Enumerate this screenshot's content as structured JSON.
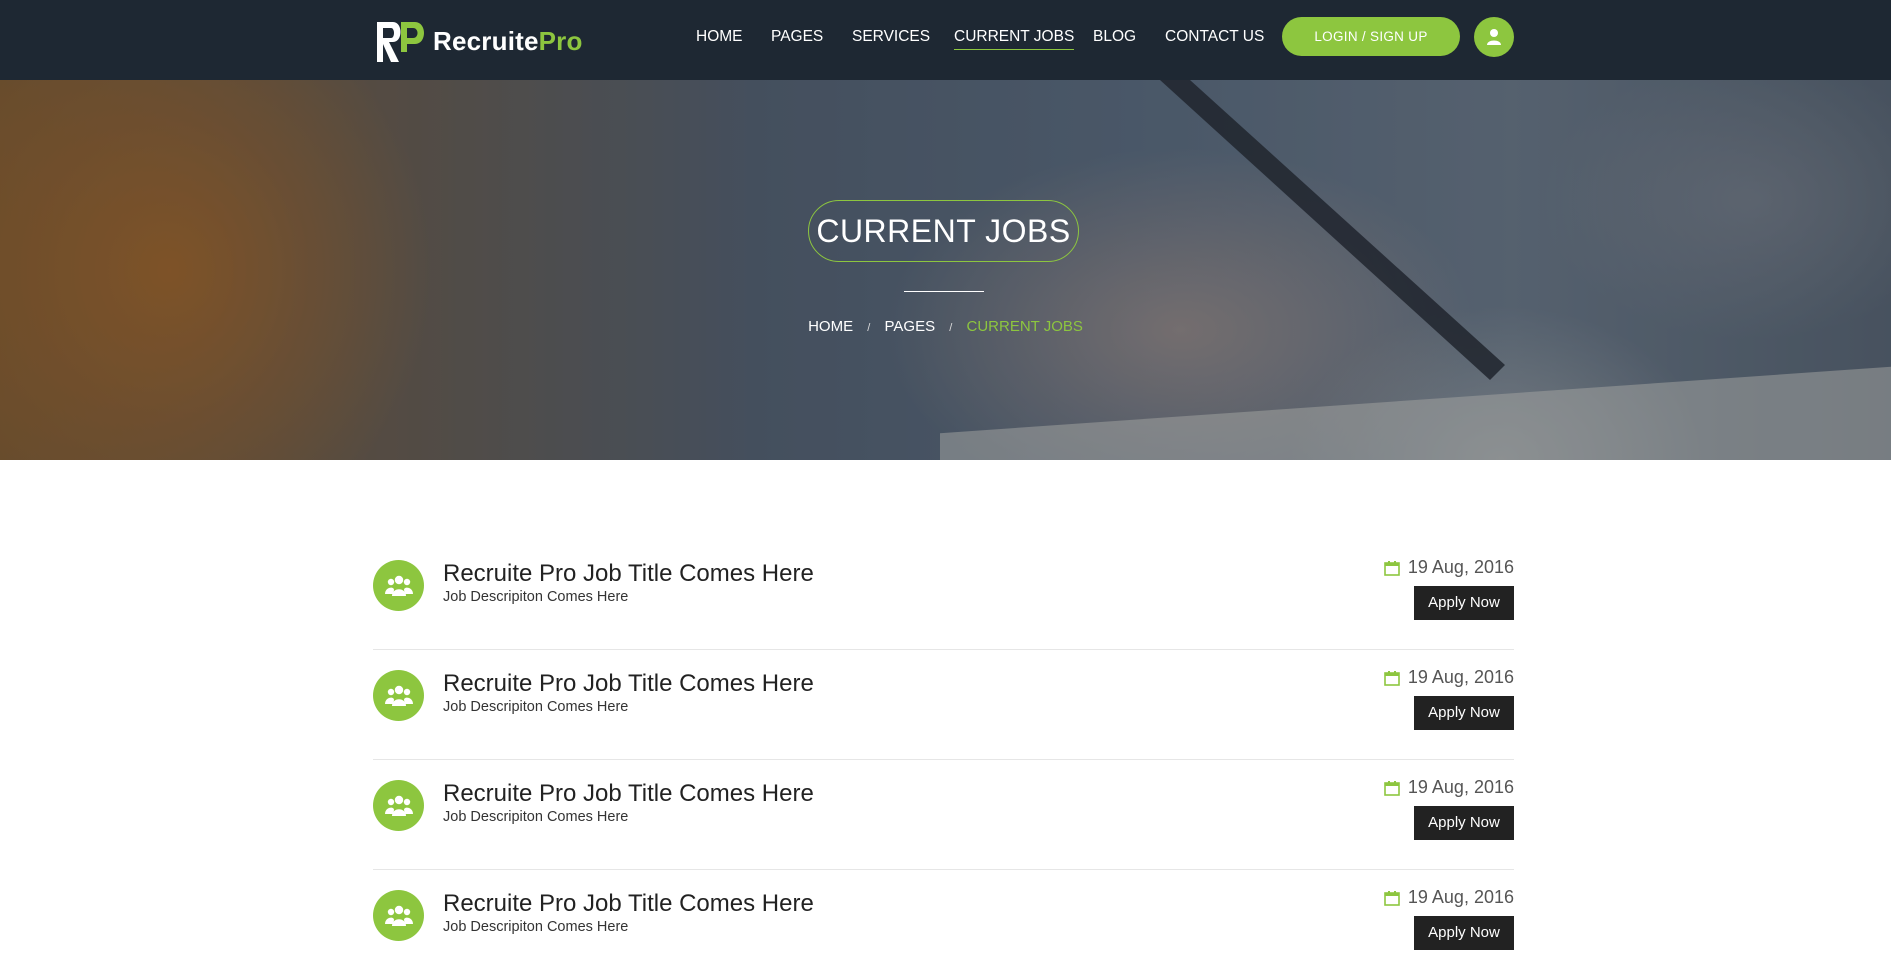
{
  "brand": {
    "name_main": "Recruite",
    "name_accent": "Pro",
    "accent_color": "#8dc63f",
    "header_bg": "#1e2833"
  },
  "nav": {
    "items": [
      {
        "label": "HOME"
      },
      {
        "label": "PAGES"
      },
      {
        "label": "SERVICES"
      },
      {
        "label": "CURRENT JOBS",
        "active": true
      },
      {
        "label": "BLOG"
      },
      {
        "label": "CONTACT US"
      }
    ],
    "login_label": "LOGIN / SIGN UP",
    "user_icon": "user-icon"
  },
  "hero": {
    "title": "CURRENT JOBS",
    "breadcrumb": [
      "HOME",
      "PAGES",
      "CURRENT JOBS"
    ],
    "separator": "/"
  },
  "jobs": [
    {
      "title": "Recruite Pro Job Title Comes Here",
      "description": "Job Descripiton Comes Here",
      "date": "19 Aug, 2016",
      "apply_label": "Apply Now",
      "icon": "users-group-icon"
    },
    {
      "title": "Recruite Pro Job Title Comes Here",
      "description": "Job Descripiton Comes Here",
      "date": "19 Aug, 2016",
      "apply_label": "Apply Now",
      "icon": "users-group-icon"
    },
    {
      "title": "Recruite Pro Job Title Comes Here",
      "description": "Job Descripiton Comes Here",
      "date": "19 Aug, 2016",
      "apply_label": "Apply Now",
      "icon": "users-group-icon"
    },
    {
      "title": "Recruite Pro Job Title Comes Here",
      "description": "Job Descripiton Comes Here",
      "date": "19 Aug, 2016",
      "apply_label": "Apply Now",
      "icon": "users-group-icon"
    }
  ]
}
